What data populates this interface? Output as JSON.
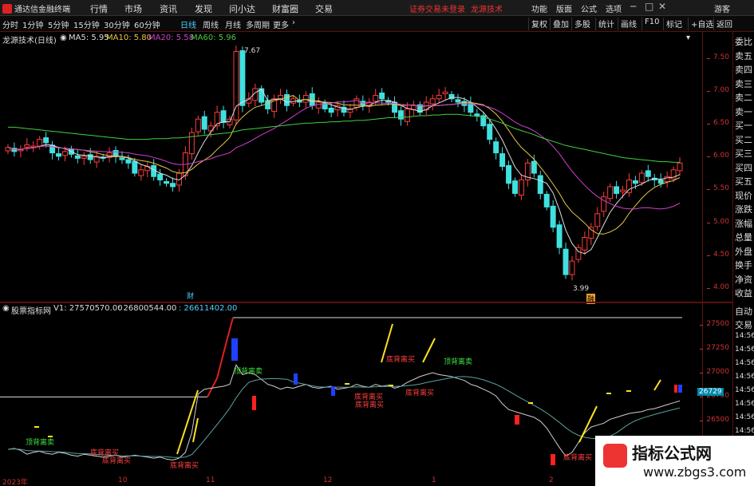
{
  "app": {
    "title": "通达信金融终端"
  },
  "menu": [
    "行情",
    "市场",
    "资讯",
    "发现",
    "问小达",
    "财富圈",
    "交易"
  ],
  "notice": "证券交易未登录",
  "broker": "龙源技术",
  "right_menu": [
    "功能",
    "版面",
    "公式",
    "选项"
  ],
  "guest": "游客",
  "periods": [
    "分时",
    "1分钟",
    "5分钟",
    "15分钟",
    "30分钟",
    "60分钟",
    "日线",
    "周线",
    "月线",
    "多周期",
    "更多"
  ],
  "active_period": "日线",
  "tools": [
    "复权",
    "叠加",
    "多股",
    "统计",
    "画线",
    "F10",
    "标记",
    "+自选",
    "返回"
  ],
  "stock": {
    "title": "龙源技术(日线)"
  },
  "ma": [
    {
      "label": "MA5: 5.95",
      "color": "#dddddd"
    },
    {
      "label": "MA10: 5.80",
      "color": "#e8c840"
    },
    {
      "label": "MA20: 5.58",
      "color": "#d040d0"
    },
    {
      "label": "MA60: 5.96",
      "color": "#40d040"
    }
  ],
  "price_ticks": [
    "7.50",
    "7.00",
    "6.50",
    "6.00",
    "5.50",
    "5.00",
    "4.50",
    "4.00"
  ],
  "price_high": "7.67",
  "price_low": "3.99",
  "marks": {
    "cai": "财",
    "rong": "融"
  },
  "indicator": {
    "name": "股票指标网",
    "v1": "V1: 27570570.00",
    "v2": ": 26800544.00",
    "v3": ": 26611402.00",
    "last_value": "26729",
    "ticks": [
      "27500",
      "27250",
      "27000",
      "26750",
      "26500",
      "26250"
    ]
  },
  "signals": {
    "top": "顶背离卖",
    "bottom": "底背离买"
  },
  "dates": [
    "2023年",
    "10",
    "11",
    "12",
    "1",
    "2"
  ],
  "side_panel": [
    "委比",
    "卖五",
    "卖四",
    "卖三",
    "卖二",
    "卖一",
    "买一",
    "买二",
    "买三",
    "买四",
    "买五",
    "现价",
    "涨跌",
    "涨幅",
    "总量",
    "外盘",
    "换手",
    "净资",
    "收益"
  ],
  "side_panel2": [
    "自动",
    "交易",
    "14:56",
    "14:56",
    "14:56",
    "14:56",
    "14:56",
    "14:56",
    "14:56",
    "14:56",
    "14:56",
    "14:56"
  ],
  "watermark": {
    "line1": "指标公式网",
    "line2": "www.zbgs3.com"
  },
  "chart_data": {
    "type": "candlestick",
    "ylim": [
      3.9,
      7.7
    ],
    "closes": [
      6.18,
      6.12,
      6.15,
      6.22,
      6.2,
      6.3,
      6.25,
      6.1,
      6.05,
      6.12,
      6.08,
      6.02,
      6.05,
      6.0,
      6.05,
      6.02,
      6.1,
      6.05,
      6.0,
      5.95,
      5.8,
      5.85,
      5.9,
      5.75,
      5.7,
      5.65,
      5.6,
      5.8,
      6.1,
      6.4,
      6.6,
      6.45,
      6.5,
      6.7,
      6.55,
      6.6,
      7.6,
      6.8,
      6.9,
      7.05,
      6.85,
      6.75,
      6.9,
      6.95,
      6.8,
      6.9,
      6.85,
      6.95,
      6.8,
      6.85,
      6.75,
      6.7,
      6.8,
      6.7,
      6.75,
      6.9,
      6.8,
      6.85,
      6.95,
      6.9,
      6.85,
      6.7,
      6.6,
      6.75,
      6.8,
      6.7,
      6.85,
      6.9,
      6.95,
      7.0,
      6.9,
      6.85,
      6.8,
      6.7,
      6.65,
      6.5,
      6.3,
      6.1,
      5.9,
      5.65,
      5.5,
      5.7,
      5.95,
      5.8,
      5.5,
      5.3,
      5.0,
      4.7,
      4.3,
      4.5,
      4.7,
      4.85,
      5.0,
      5.2,
      5.45,
      5.6,
      5.5,
      5.55,
      5.7,
      5.65,
      5.8,
      5.75,
      5.7,
      5.65,
      5.75,
      5.85,
      5.95
    ],
    "ma60": [
      6.48,
      6.48,
      6.47,
      6.46,
      6.45,
      6.44,
      6.43,
      6.42,
      6.41,
      6.4,
      6.39,
      6.38,
      6.37,
      6.36,
      6.35,
      6.34,
      6.33,
      6.32,
      6.31,
      6.3,
      6.3,
      6.3,
      6.3,
      6.31,
      6.31,
      6.31,
      6.32,
      6.32,
      6.33,
      6.34,
      6.35,
      6.36,
      6.37,
      6.38,
      6.39,
      6.4,
      6.42,
      6.44,
      6.45,
      6.46,
      6.47,
      6.48,
      6.49,
      6.5,
      6.51,
      6.52,
      6.53,
      6.54,
      6.54,
      6.55,
      6.55,
      6.56,
      6.56,
      6.57,
      6.57,
      6.58,
      6.58,
      6.59,
      6.6,
      6.61,
      6.62,
      6.62,
      6.63,
      6.63,
      6.64,
      6.65,
      6.65,
      6.66,
      6.66,
      6.67,
      6.67,
      6.67,
      6.66,
      6.65,
      6.64,
      6.63,
      6.6,
      6.57,
      6.54,
      6.5,
      6.46,
      6.43,
      6.4,
      6.37,
      6.33,
      6.3,
      6.27,
      6.24,
      6.21,
      6.19,
      6.17,
      6.15,
      6.13,
      6.11,
      6.09,
      6.07,
      6.05,
      6.03,
      6.02,
      6.01,
      6.0,
      5.99,
      5.98,
      5.97,
      5.97,
      5.96,
      5.96
    ],
    "indicator_line": [
      26230,
      26240,
      26220,
      26180,
      26200,
      26210,
      26190,
      26180,
      26200,
      26190,
      26170,
      26160,
      26180,
      26170,
      26160,
      26150,
      26160,
      26170,
      26150,
      26160,
      26170,
      26160,
      26150,
      26140,
      26150,
      26130,
      26120,
      26140,
      26200,
      26400,
      26800,
      26850,
      26860,
      26870,
      26880,
      26900,
      27100,
      27000,
      27020,
      27000,
      26950,
      26900,
      26880,
      26850,
      26870,
      26860,
      26880,
      26900,
      26870,
      26860,
      26870,
      26880,
      26850,
      26860,
      26870,
      26900,
      26880,
      26870,
      26900,
      26880,
      26890,
      26860,
      26880,
      26920,
      26950,
      26980,
      27000,
      27020,
      27000,
      26990,
      26980,
      26960,
      26940,
      26900,
      26880,
      26850,
      26820,
      26780,
      26700,
      26640,
      26620,
      26600,
      26580,
      26560,
      26520,
      26450,
      26350,
      26250,
      26160,
      26200,
      26300,
      26400,
      26460,
      26480,
      26500,
      26540,
      26560,
      26580,
      26600,
      26610,
      26620,
      26640,
      26650,
      26670,
      26690,
      26710,
      26729
    ],
    "baseline": 26770
  }
}
